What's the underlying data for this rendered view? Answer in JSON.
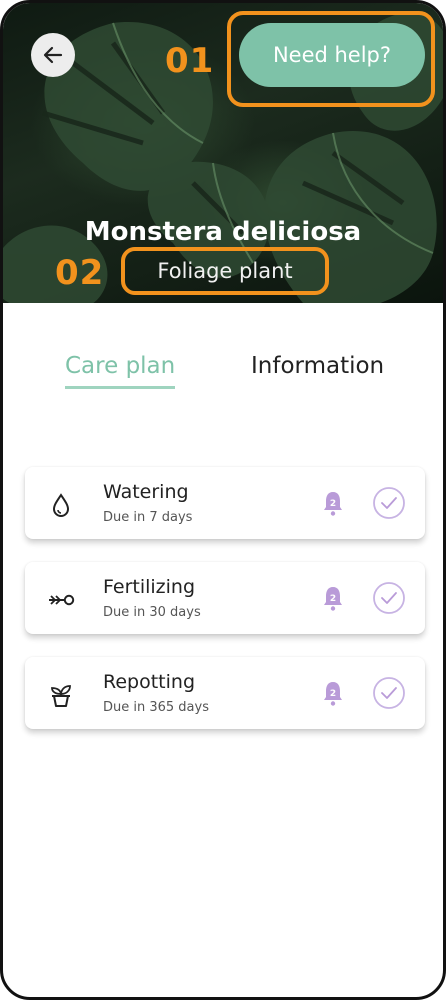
{
  "header": {
    "help_label": "Need help?",
    "plant_name": "Monstera deliciosa",
    "plant_type": "Foliage plant"
  },
  "annotations": [
    {
      "label": "01"
    },
    {
      "label": "02"
    }
  ],
  "tabs": [
    {
      "label": "Care plan",
      "active": true
    },
    {
      "label": "Information",
      "active": false
    }
  ],
  "tasks": [
    {
      "title": "Watering",
      "due": "Due in 7 days",
      "icon": "water-drop-icon",
      "reminder_badge": "2"
    },
    {
      "title": "Fertilizing",
      "due": "Due in 30 days",
      "icon": "fertilizer-icon",
      "reminder_badge": "2"
    },
    {
      "title": "Repotting",
      "due": "Due in 365 days",
      "icon": "plant-pot-icon",
      "reminder_badge": "2"
    }
  ],
  "colors": {
    "accent": "#7ec2a8",
    "annotation": "#f2921d",
    "reminder": "#b99bd8",
    "check": "#c7b3e3"
  }
}
